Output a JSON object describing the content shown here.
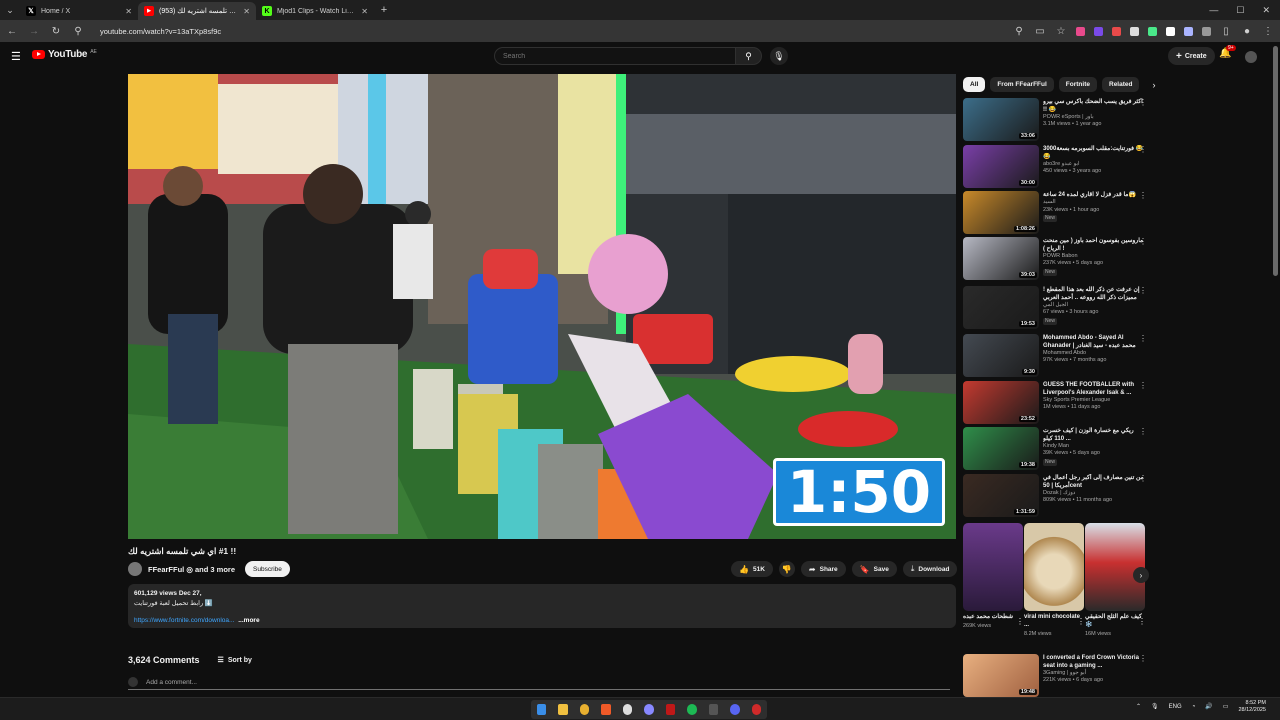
{
  "browser": {
    "tabs": [
      {
        "title": "Home / X",
        "favicon": "X",
        "color": "#000000",
        "active": false
      },
      {
        "title": "(953) اي شي تلمسه اشتريه لك !!",
        "favicon": "▶",
        "color": "#ff0000",
        "active": true
      },
      {
        "title": "Mjod1 Clips - Watch Live on Ki",
        "favicon": "K",
        "color": "#53fc18",
        "active": false
      }
    ],
    "url": "youtube.com/watch?v=13aTXp8sf9c"
  },
  "masthead": {
    "logo_text": "YouTube",
    "logo_region": "AE",
    "search_placeholder": "Search",
    "create_label": "Create",
    "notif_count": "9+"
  },
  "video": {
    "overlay_timer": "1:50",
    "title": "!! #1 اي شي تلمسه اشتريه لك",
    "channel": "FFearFFul",
    "channel_suffix": "and 3 more",
    "subscribe_label": "Subscribe",
    "likes": "51K",
    "share_label": "Share",
    "save_label": "Save",
    "download_label": "Download",
    "views_date": "601,129 views  Dec 27,",
    "desc_line": "رابط تحميل لعبة فورتنايت ⬇️",
    "desc_link": "https://www.fortnite.com/downloa...",
    "more_label": "...more"
  },
  "comments": {
    "count": "3,624 Comments",
    "sort_label": "Sort by",
    "add_placeholder": "Add a comment..."
  },
  "sidebar": {
    "chips": [
      "All",
      "From FFearFFul",
      "Fortnite",
      "Related"
    ],
    "recs": [
      {
        "title": "اكثر فريق يسب الضحك بأكرس سي بيرو !! 😂",
        "channel": "POWR eSports | باور",
        "views": "3.1M views • 1 year ago",
        "duration": "33:06",
        "new": "",
        "thumb": "#3c6e8a"
      },
      {
        "title": "فورتنايت:مقلب السوبرمه بسعة3000 😂😂",
        "channel": "abo3re ابو عبدو",
        "views": "450 views • 3 years ago",
        "duration": "30:00",
        "new": "",
        "thumb": "#7a3fa8"
      },
      {
        "title": "ما قدر فزل لا اقاري لمده 24 ساعة😱",
        "channel": "السيد",
        "views": "23K views • 1 hour ago",
        "duration": "1:08:26",
        "new": "New",
        "thumb": "#c98a2a"
      },
      {
        "title": "ماروسين بفوسون احمد باوز ( مين منحت الرياح ) !",
        "channel": "POWR Babon",
        "views": "237K views • 5 days ago",
        "duration": "39:03",
        "new": "New",
        "thumb": "#b7b9c4"
      },
      {
        "title": "إن عرفت عن ذكر الله بعد هذا المقطع ! مميزات ذكر الله رووعه .. أحمد العربي",
        "channel": "الجيل المي",
        "views": "67 views • 3 hours ago",
        "duration": "19:53",
        "new": "New",
        "thumb": "#2a2a2a"
      },
      {
        "title": "Mohammed Abdo - Sayed Al Ghanader | محمد عبده - سيد الغنادر",
        "channel": "Mohammed Abdo",
        "views": "97K views • 7 months ago",
        "duration": "9:30",
        "new": "",
        "thumb": "#444a52"
      },
      {
        "title": "GUESS THE FOOTBALLER with Liverpool's Alexander Isak & ...",
        "channel": "Sky Sports Premier League",
        "views": "1M views • 11 days ago",
        "duration": "23:52",
        "new": "",
        "thumb": "#c43a30"
      },
      {
        "title": "ريكي مع خسارة الوزن | كيف خسرت 110 كيلو ...",
        "channel": "Kindy Man",
        "views": "39K views • 5 days ago",
        "duration": "19:38",
        "new": "New",
        "thumb": "#2f8f4a"
      },
      {
        "title": "من تنين مصارف إلى أكبر رجل أعمال في أمريكا | 50cent",
        "channel": "Dozak | دوزك",
        "views": "809K views • 11 months ago",
        "duration": "1:31:59",
        "new": "",
        "thumb": "#3a2a22"
      }
    ],
    "shorts": [
      {
        "title": "شطحات محمد عبده",
        "views": "269K views",
        "thumb": "#5a2a7a"
      },
      {
        "title": "viral mini chocolate ...",
        "views": "8.2M views",
        "thumb": "#d8c8a8"
      },
      {
        "title": "كيف علم الثلج الحقيقي ❄️",
        "views": "16M views",
        "thumb": "#b02a2a"
      }
    ],
    "last_rec": {
      "title": "I converted a Ford Crown Victoria seat into a gaming ...",
      "channel": "3Gaming | أبو جوو",
      "views": "221K views • 6 days ago",
      "duration": "19:48",
      "thumb": "#d89a6a"
    }
  },
  "taskbar": {
    "lang": "ENG",
    "time": "8:52 PM",
    "date": "28/12/2025"
  }
}
